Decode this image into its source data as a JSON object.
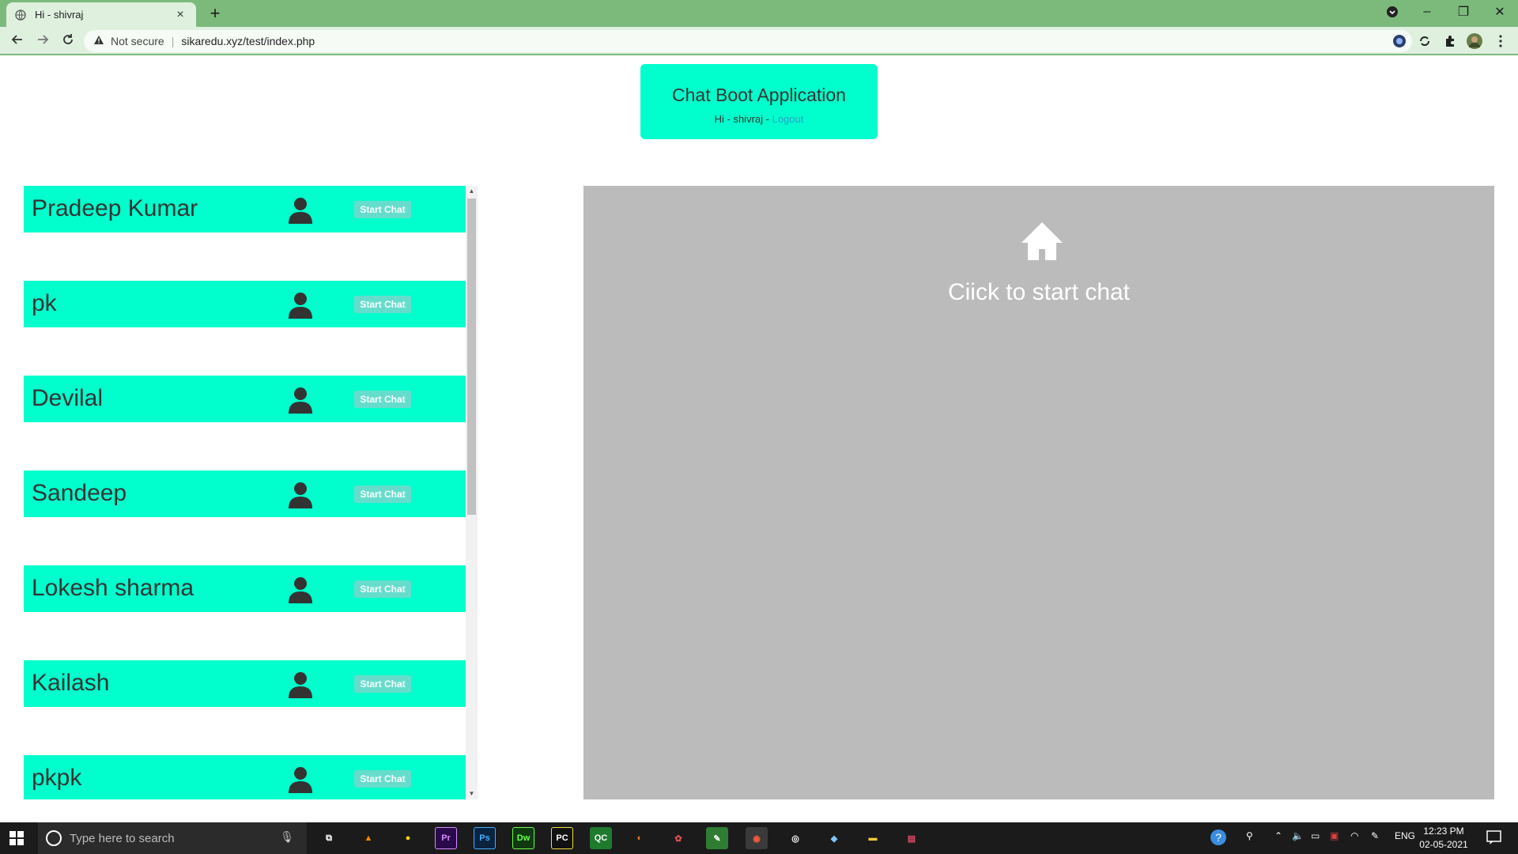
{
  "browser": {
    "tab_title": "Hi - shivraj",
    "tab_close": "×",
    "new_tab": "+",
    "security_label": "Not secure",
    "url": "sikaredu.xyz/test/index.php",
    "window_controls": {
      "minimize": "–",
      "restore": "❐",
      "close": "✕"
    }
  },
  "header": {
    "title": "Chat Boot Application",
    "greeting": "Hi - shivraj",
    "separator": " - ",
    "logout_label": "Logout"
  },
  "users": [
    {
      "name": "Pradeep Kumar",
      "button": "Start Chat"
    },
    {
      "name": "pk",
      "button": "Start Chat"
    },
    {
      "name": "Devilal",
      "button": "Start Chat"
    },
    {
      "name": "Sandeep",
      "button": "Start Chat"
    },
    {
      "name": "Lokesh sharma",
      "button": "Start Chat"
    },
    {
      "name": "Kailash",
      "button": "Start Chat"
    },
    {
      "name": "pkpk",
      "button": "Start Chat"
    }
  ],
  "chat": {
    "icon": "home-icon",
    "prompt": "Ciick to start chat"
  },
  "taskbar": {
    "search_placeholder": "Type here to search",
    "language": "ENG",
    "time": "12:23 PM",
    "date": "02-05-2021",
    "apps": [
      {
        "name": "task-view",
        "label": "⧉",
        "color": "#1b1b1b"
      },
      {
        "name": "vlc",
        "label": "▲",
        "color": "#1b1b1b"
      },
      {
        "name": "app-yellow",
        "label": "●",
        "color": "#1b1b1b"
      },
      {
        "name": "premiere",
        "label": "Pr",
        "color": "#2a0a4a"
      },
      {
        "name": "photoshop",
        "label": "Ps",
        "color": "#0a2340"
      },
      {
        "name": "dreamweaver",
        "label": "Dw",
        "color": "#0f3a0f"
      },
      {
        "name": "pycharm",
        "label": "PC",
        "color": "#111111"
      },
      {
        "name": "qc",
        "label": "QC",
        "color": "#1e7b2e"
      },
      {
        "name": "app-circle",
        "label": "◐",
        "color": "#1b1b1b"
      },
      {
        "name": "app-grapes",
        "label": "✿",
        "color": "#1b1b1b"
      },
      {
        "name": "notepad-green",
        "label": "✎",
        "color": "#2e7d32"
      },
      {
        "name": "chrome",
        "label": "◉",
        "color": "#3a3a3a"
      },
      {
        "name": "obs",
        "label": "◎",
        "color": "#1b1b1b"
      },
      {
        "name": "app-blue",
        "label": "◆",
        "color": "#1b1b1b"
      },
      {
        "name": "file-explorer",
        "label": "▬",
        "color": "#1b1b1b"
      },
      {
        "name": "app-flag",
        "label": "▤",
        "color": "#1b1b1b"
      }
    ]
  },
  "colors": {
    "accent": "#00ffcc",
    "chrome_frame": "#7cba7c",
    "chat_panel": "#bbbbbb",
    "link": "#2aa0c8"
  }
}
